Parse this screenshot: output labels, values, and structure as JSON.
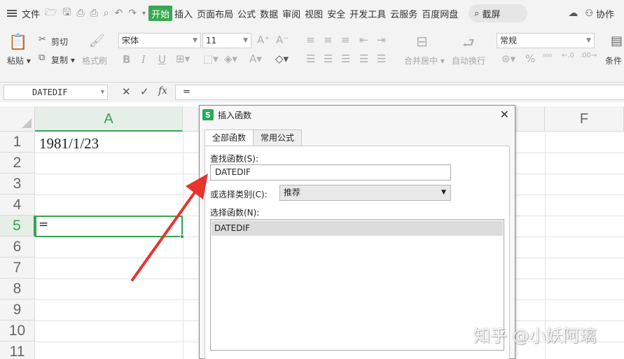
{
  "menubar": {
    "file": "文件",
    "tabs": [
      "开始",
      "插入",
      "页面布局",
      "公式",
      "数据",
      "审阅",
      "视图",
      "安全",
      "开发工具",
      "云服务",
      "百度网盘"
    ],
    "search": "截屏",
    "collab": "协作"
  },
  "ribbon": {
    "paste": "粘贴",
    "cut": "剪切",
    "copy": "复制",
    "format_painter": "格式刷",
    "font_name": "宋体",
    "font_size": "11",
    "merge_center": "合并居中",
    "wrap_text": "自动换行",
    "number_format": "常规",
    "conditional": "条件"
  },
  "formula_bar": {
    "name_box": "DATEDIF",
    "fx": "fx",
    "content": "="
  },
  "grid": {
    "columns": [
      "A",
      "F"
    ],
    "rows": [
      "1",
      "2",
      "3",
      "4",
      "5",
      "6",
      "7",
      "8",
      "9",
      "10",
      "11"
    ],
    "a1": "1981/1/23",
    "a5": "="
  },
  "dialog": {
    "title": "插入函数",
    "tab_all": "全部函数",
    "tab_common": "常用公式",
    "search_label": "查找函数(S):",
    "search_value": "DATEDIF",
    "category_label": "或选择类别(C):",
    "category_value": "推荐",
    "select_label": "选择函数(N):",
    "functions": [
      "DATEDIF"
    ]
  },
  "watermark": "知乎 @小妖阿璃",
  "colors": {
    "accent": "#37a352",
    "arrow": "#e8332f"
  }
}
